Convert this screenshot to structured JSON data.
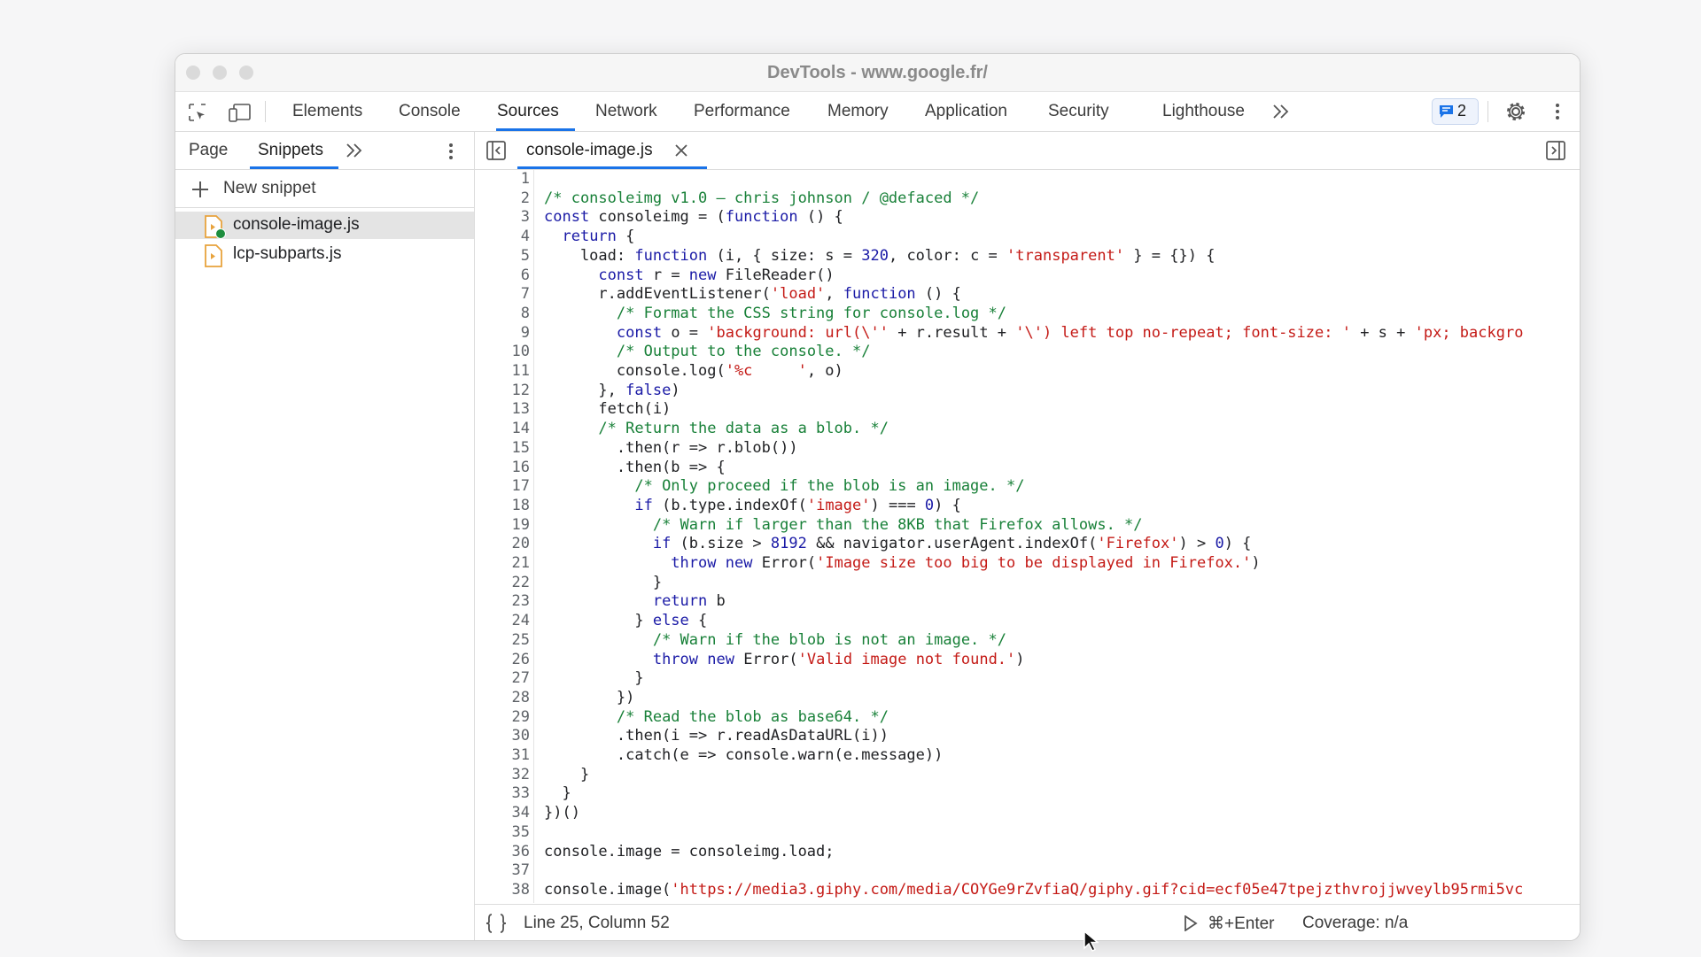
{
  "window": {
    "title": "DevTools - www.google.fr/"
  },
  "toolbar": {
    "tabs": [
      "Elements",
      "Console",
      "Sources",
      "Network",
      "Performance",
      "Memory",
      "Application",
      "Security",
      "Lighthouse"
    ],
    "active_tab": "Sources",
    "issues_count": "2"
  },
  "navigator": {
    "tabs": [
      "Page",
      "Snippets"
    ],
    "active_tab": "Snippets",
    "new_snippet_label": "New snippet",
    "files": [
      "console-image.js",
      "lcp-subparts.js"
    ],
    "selected_file": "console-image.js"
  },
  "editor": {
    "open_tab": "console-image.js",
    "lines": [
      "",
      "/* consoleimg v1.0 – chris johnson / @defaced */",
      "const consoleimg = (function () {",
      "  return {",
      "    load: function (i, { size: s = 320, color: c = 'transparent' } = {}) {",
      "      const r = new FileReader()",
      "      r.addEventListener('load', function () {",
      "        /* Format the CSS string for console.log */",
      "        const o = 'background: url(\\'' + r.result + '\\') left top no-repeat; font-size: ' + s + 'px; backgro",
      "        /* Output to the console. */",
      "        console.log('%c     ', o)",
      "      }, false)",
      "      fetch(i)",
      "      /* Return the data as a blob. */",
      "        .then(r => r.blob())",
      "        .then(b => {",
      "          /* Only proceed if the blob is an image. */",
      "          if (b.type.indexOf('image') === 0) {",
      "            /* Warn if larger than the 8KB that Firefox allows. */",
      "            if (b.size > 8192 && navigator.userAgent.indexOf('Firefox') > 0) {",
      "              throw new Error('Image size too big to be displayed in Firefox.')",
      "            }",
      "            return b",
      "          } else {",
      "            /* Warn if the blob is not an image. */",
      "            throw new Error('Valid image not found.')",
      "          }",
      "        })",
      "        /* Read the blob as base64. */",
      "        .then(i => r.readAsDataURL(i))",
      "        .catch(e => console.warn(e.message))",
      "    }",
      "  }",
      "})()",
      "",
      "console.image = consoleimg.load;",
      "",
      "console.image('https://media3.giphy.com/media/COYGe9rZvfiaQ/giphy.gif?cid=ecf05e47tpejzthvrojjwveylb95rmi5vc"
    ]
  },
  "status": {
    "position": "Line 25, Column 52",
    "run_shortcut": "⌘+Enter",
    "coverage": "Coverage: n/a"
  }
}
